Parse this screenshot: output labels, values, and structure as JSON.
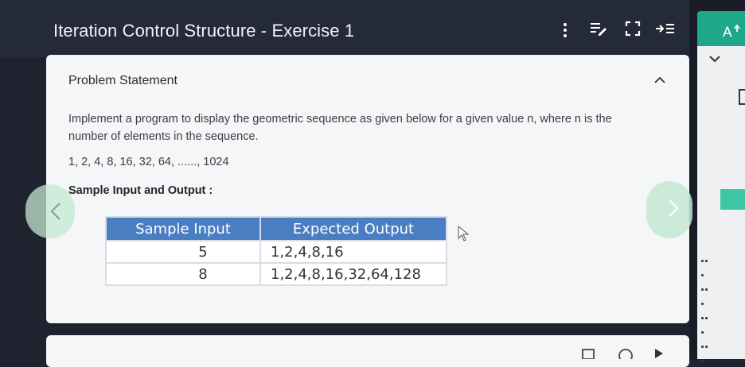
{
  "header": {
    "title": "Iteration Control Structure - Exercise 1",
    "icons": [
      "more-vertical-icon",
      "list-edit-icon",
      "fullscreen-icon",
      "collapse-right-icon"
    ]
  },
  "right_panel": {
    "icons": [
      "font-size-icon",
      "chevron-down-icon",
      "drag-handle-icon"
    ],
    "accent_color": "#1fa789"
  },
  "problem": {
    "heading": "Problem Statement",
    "statement": "Implement a program to display the geometric sequence as given below for a given value n, where n is the number of elements in the sequence.",
    "sequence": "1, 2, 4, 8, 16, 32, 64, ......, 1024",
    "sample_heading": "Sample Input and Output :",
    "table": {
      "headers": [
        "Sample Input",
        "Expected Output"
      ],
      "rows": [
        [
          "5",
          "1,2,4,8,16"
        ],
        [
          "8",
          "1,2,4,8,16,32,64,128"
        ]
      ],
      "header_color": "#4a7ec2"
    }
  }
}
